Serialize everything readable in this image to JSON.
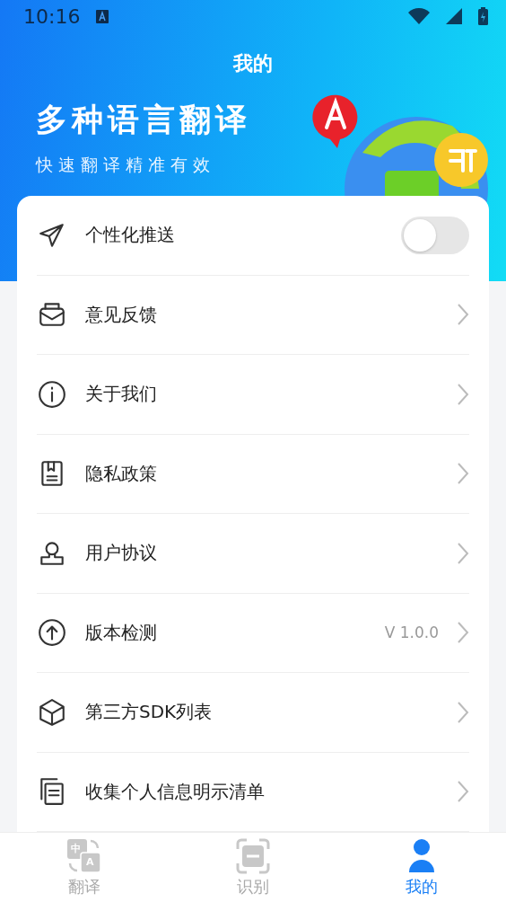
{
  "status_bar": {
    "time": "10:16"
  },
  "header": {
    "title": "我的",
    "headline": "多种语言翻译",
    "subline": "快速翻译精准有效"
  },
  "menu": [
    {
      "kind": "toggle",
      "label": "个性化推送",
      "on": false
    },
    {
      "kind": "link",
      "label": "意见反馈"
    },
    {
      "kind": "link",
      "label": "关于我们"
    },
    {
      "kind": "link",
      "label": "隐私政策"
    },
    {
      "kind": "link",
      "label": "用户协议"
    },
    {
      "kind": "link",
      "label": "版本检测",
      "value": "V 1.0.0"
    },
    {
      "kind": "link",
      "label": "第三方SDK列表"
    },
    {
      "kind": "link",
      "label": "收集个人信息明示清单"
    }
  ],
  "tabs": [
    {
      "kind": "translate",
      "label": "翻译",
      "glyphs": [
        "中",
        "A"
      ],
      "selected": false
    },
    {
      "kind": "scan",
      "label": "识别",
      "selected": false
    },
    {
      "kind": "me",
      "label": "我的",
      "selected": true
    }
  ]
}
